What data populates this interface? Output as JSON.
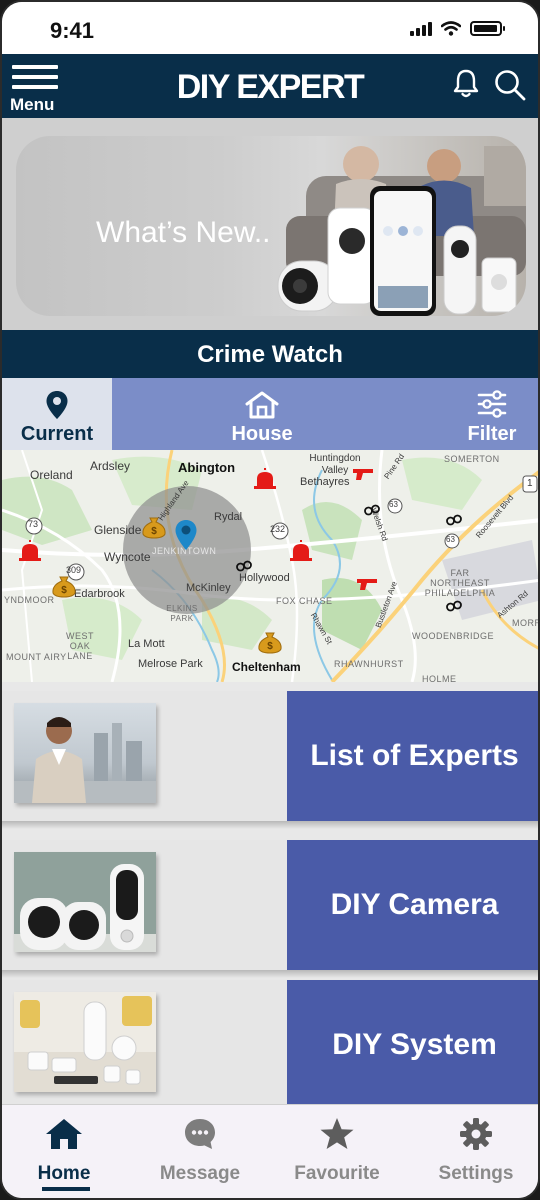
{
  "status_bar": {
    "time": "9:41"
  },
  "header": {
    "menu_label": "Menu",
    "title": "DIY EXPERT"
  },
  "banner": {
    "text": "What’s New.."
  },
  "crime_watch": {
    "title": "Crime Watch",
    "tabs": [
      {
        "label": "Current",
        "icon": "location-pin-icon",
        "selected": true
      },
      {
        "label": "House",
        "icon": "house-icon",
        "selected": false
      },
      {
        "label": "Filter",
        "icon": "sliders-icon",
        "selected": false
      }
    ]
  },
  "map": {
    "places": [
      "Oreland",
      "Ardsley",
      "Abington",
      "Huntingdon Valley",
      "Bethayres",
      "SOMERTON",
      "Rydal",
      "Glenside",
      "Wyncote",
      "JENKINTOWN",
      "McKinley",
      "Hollywood",
      "Edarbrook",
      "ELKINS PARK",
      "FOX CHASE",
      "FAR NORTHEAST PHILADELPHIA",
      "WOODENBRIDGE",
      "WEST OAK LANE",
      "La Mott",
      "MOUNT AIRY",
      "Melrose Park",
      "Cheltenham",
      "RHAWNHURST",
      "YNDMOOR",
      "Highland Ave",
      "Pine Rd",
      "Welsh Rd",
      "Roosevelt Blvd",
      "Rhawn St",
      "Bustleton Ave",
      "Ashton Rd",
      "HOLME",
      "MORRI"
    ],
    "road_numbers": [
      "73",
      "309",
      "232",
      "63",
      "63",
      "1"
    ],
    "marker_colors": {
      "alarm": "#e41b17",
      "money": "#d89a1c",
      "pin": "#1e88c9",
      "radius": "#8f8f8f"
    }
  },
  "cards": [
    {
      "label": "List of Experts",
      "image": "expert-portrait-image"
    },
    {
      "label": "DIY Camera",
      "image": "security-cameras-image"
    },
    {
      "label": "DIY System",
      "image": "home-security-system-image"
    }
  ],
  "bottom_nav": [
    {
      "label": "Home",
      "icon": "home-icon",
      "active": true
    },
    {
      "label": "Message",
      "icon": "message-icon",
      "active": false
    },
    {
      "label": "Favourite",
      "icon": "star-icon",
      "active": false
    },
    {
      "label": "Settings",
      "icon": "gear-icon",
      "active": false
    }
  ],
  "colors": {
    "header": "#092e49",
    "tab_bar": "#7b8dc8",
    "card_button": "#4a5ba8",
    "nav_inactive": "#8a8a8a"
  }
}
